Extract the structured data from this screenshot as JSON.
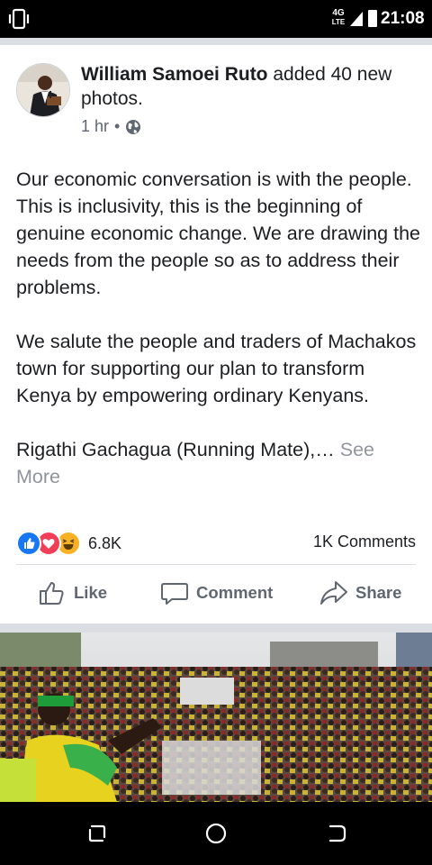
{
  "status_bar": {
    "network_top": "4G",
    "network_bottom": "LTE",
    "time": "21:08"
  },
  "post": {
    "author": "William Samoei Ruto",
    "action_text": "added 40 new photos.",
    "time_ago": "1 hr",
    "dot": "•",
    "privacy_icon": "globe-icon",
    "paragraphs": [
      "Our economic conversation is with the people. This is inclusivity, this is the beginning of genuine economic change. We are drawing the needs from the people so as to address their problems.",
      "We salute the people and traders of Machakos town for supporting our plan to transform Kenya by empowering ordinary Kenyans."
    ],
    "truncated_text": "Rigathi Gachagua (Running Mate),…",
    "see_more": "See More",
    "reactions_count": "6.8K",
    "comments_count": "1K Comments",
    "reaction_icons": [
      "like-reaction-icon",
      "love-reaction-icon",
      "haha-reaction-icon"
    ]
  },
  "actions": {
    "like": "Like",
    "comment": "Comment",
    "share": "Share"
  },
  "colors": {
    "facebook_blue": "#1877f2",
    "love_red": "#f33e58",
    "haha_yellow": "#f7b125",
    "secondary_text": "#606770",
    "divider": "#dadde1"
  }
}
